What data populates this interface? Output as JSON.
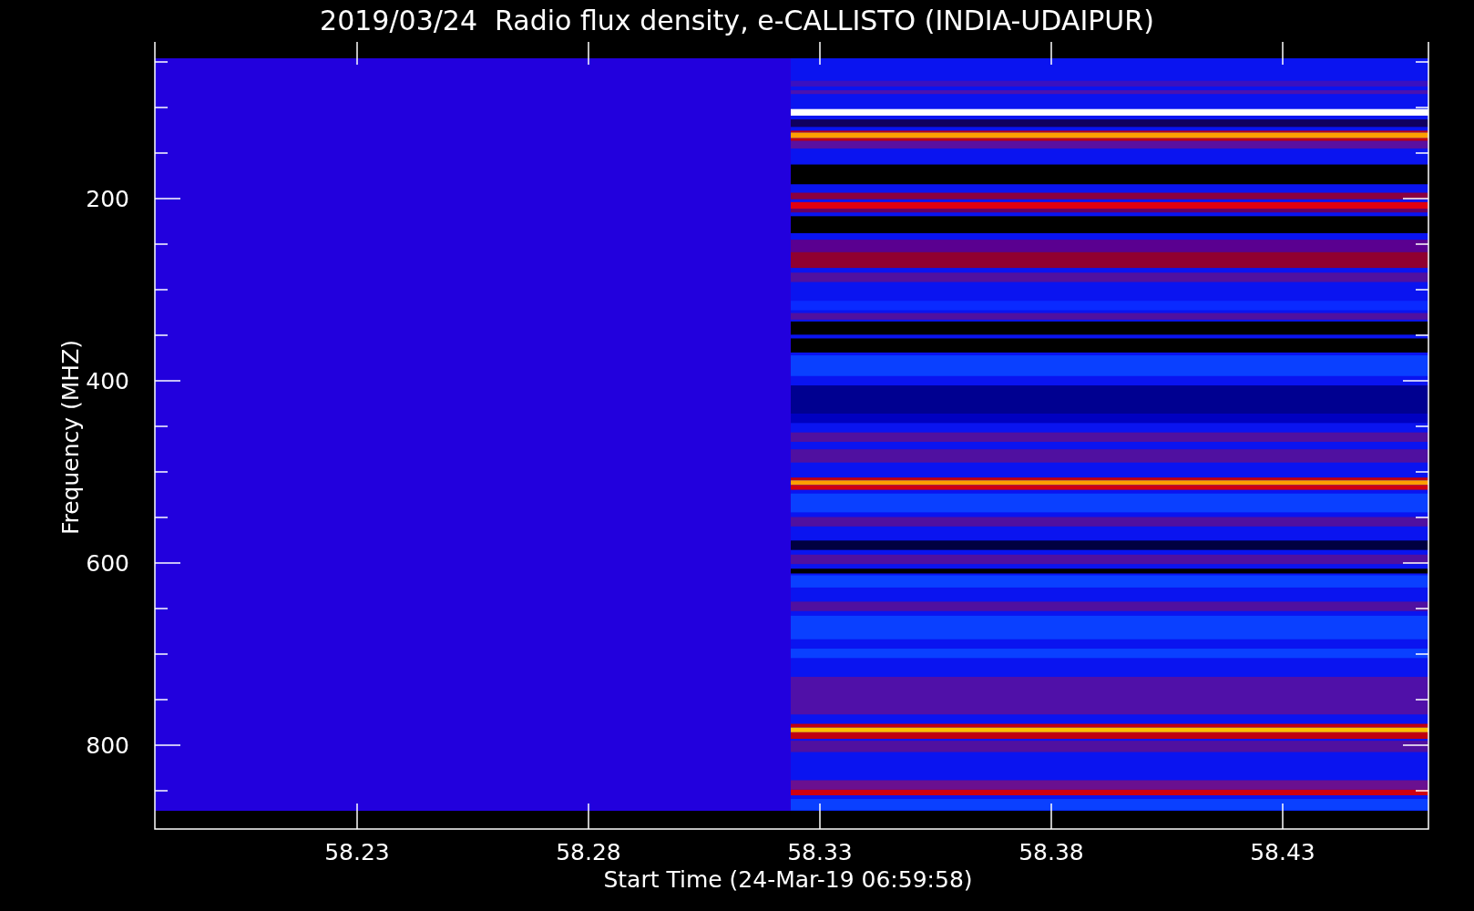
{
  "title": "2019/03/24  Radio flux density, e-CALLISTO (INDIA-UDAIPUR)",
  "y_axis": {
    "label": "Frequency (MHZ)",
    "tick_labels": [
      "200",
      "400",
      "600",
      "800"
    ]
  },
  "x_axis": {
    "label": "Start Time (24-Mar-19 06:59:58)",
    "tick_labels": [
      "58.23",
      "58.28",
      "58.33",
      "58.38",
      "58.43"
    ]
  }
}
